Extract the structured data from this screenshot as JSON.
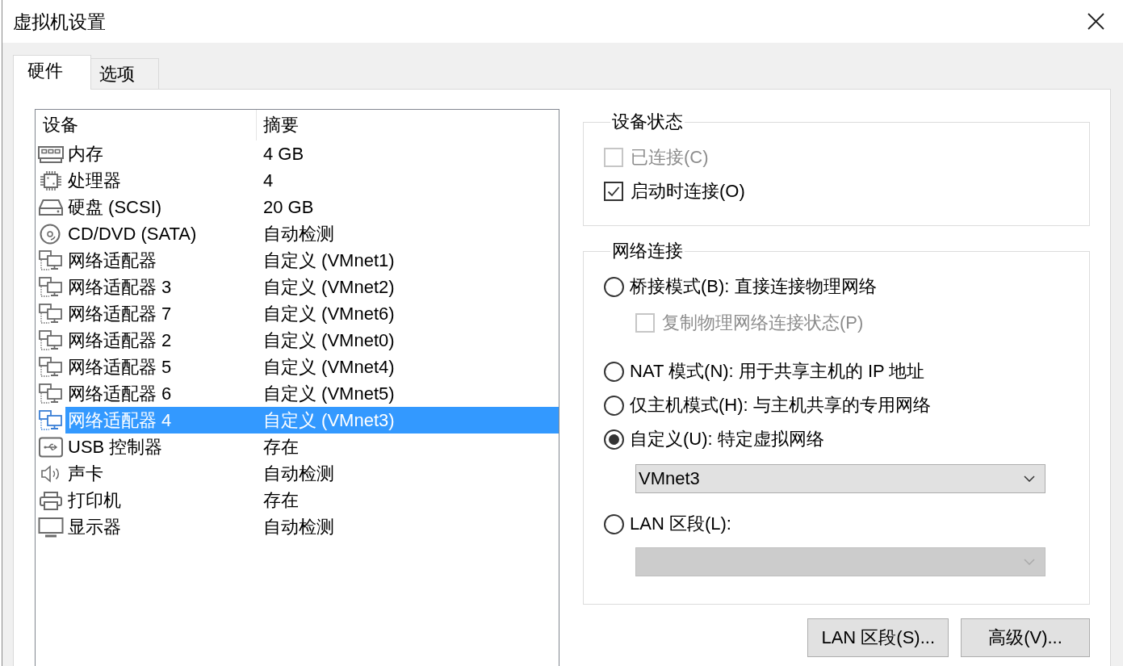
{
  "window": {
    "title": "虚拟机设置"
  },
  "tabs": [
    {
      "label": "硬件",
      "selected": true
    },
    {
      "label": "选项",
      "selected": false
    }
  ],
  "device_list": {
    "columns": [
      "设备",
      "摘要"
    ],
    "rows": [
      {
        "kind": "memory",
        "device": "内存",
        "summary": "4 GB",
        "selected": false
      },
      {
        "kind": "processor",
        "device": "处理器",
        "summary": "4",
        "selected": false
      },
      {
        "kind": "disk",
        "device": "硬盘 (SCSI)",
        "summary": "20 GB",
        "selected": false
      },
      {
        "kind": "cd",
        "device": "CD/DVD (SATA)",
        "summary": "自动检测",
        "selected": false
      },
      {
        "kind": "network",
        "device": "网络适配器",
        "summary": "自定义 (VMnet1)",
        "selected": false
      },
      {
        "kind": "network",
        "device": "网络适配器 3",
        "summary": "自定义 (VMnet2)",
        "selected": false
      },
      {
        "kind": "network",
        "device": "网络适配器 7",
        "summary": "自定义 (VMnet6)",
        "selected": false
      },
      {
        "kind": "network",
        "device": "网络适配器 2",
        "summary": "自定义 (VMnet0)",
        "selected": false
      },
      {
        "kind": "network",
        "device": "网络适配器 5",
        "summary": "自定义 (VMnet4)",
        "selected": false
      },
      {
        "kind": "network",
        "device": "网络适配器 6",
        "summary": "自定义 (VMnet5)",
        "selected": false
      },
      {
        "kind": "network",
        "device": "网络适配器 4",
        "summary": "自定义 (VMnet3)",
        "selected": true
      },
      {
        "kind": "usb",
        "device": "USB 控制器",
        "summary": "存在",
        "selected": false
      },
      {
        "kind": "sound",
        "device": "声卡",
        "summary": "自动检测",
        "selected": false
      },
      {
        "kind": "printer",
        "device": "打印机",
        "summary": "存在",
        "selected": false
      },
      {
        "kind": "display",
        "device": "显示器",
        "summary": "自动检测",
        "selected": false
      }
    ]
  },
  "device_status": {
    "title": "设备状态",
    "options": [
      {
        "label": "已连接(C)",
        "checked": false,
        "disabled": true
      },
      {
        "label": "启动时连接(O)",
        "checked": true,
        "disabled": false
      }
    ]
  },
  "network_connection": {
    "title": "网络连接",
    "modes": [
      {
        "label": "桥接模式(B): 直接连接物理网络",
        "selected": false,
        "sub_option": {
          "label": "复制物理网络连接状态(P)",
          "checked": false,
          "disabled": true
        }
      },
      {
        "label": "NAT 模式(N): 用于共享主机的 IP 地址",
        "selected": false
      },
      {
        "label": "仅主机模式(H): 与主机共享的专用网络",
        "selected": false
      },
      {
        "label": "自定义(U): 特定虚拟网络",
        "selected": true,
        "dropdown": {
          "value": "VMnet3",
          "disabled": false
        }
      },
      {
        "label": "LAN 区段(L):",
        "selected": false,
        "dropdown": {
          "disabled": true
        }
      }
    ]
  },
  "buttons": [
    "LAN 区段(S)...",
    "高级(V)..."
  ]
}
